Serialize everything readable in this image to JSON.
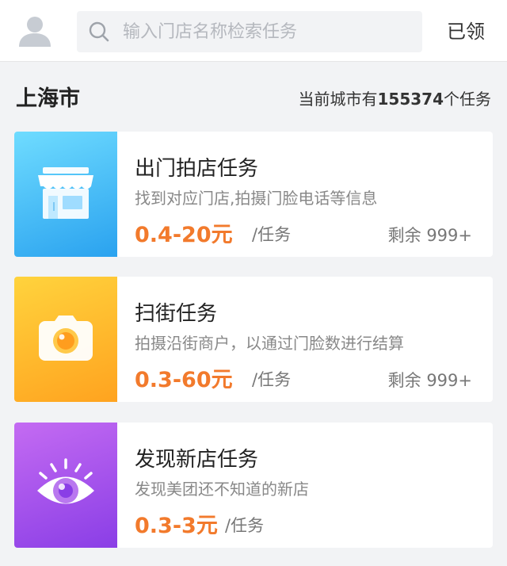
{
  "header": {
    "avatar_icon": "user-avatar-icon",
    "search": {
      "icon": "search-icon",
      "placeholder": "输入门店名称检索任务",
      "value": ""
    },
    "claimed_label": "已领"
  },
  "city": {
    "name": "上海市",
    "summary_prefix": "当前城市有",
    "task_count": "155374",
    "summary_suffix": "个任务"
  },
  "tasks": [
    {
      "title": "出门拍店任务",
      "description": "找到对应门店,拍摄门脸电话等信息",
      "price": "0.4-20元",
      "unit": "/任务",
      "remaining": "剩余 999+",
      "icon": "storefront-icon",
      "gradient_colors": [
        "#6fdcff",
        "#2aa2ef"
      ]
    },
    {
      "title": "扫街任务",
      "description": "拍摄沿街商户，以通过门脸数进行结算",
      "price": "0.3-60元",
      "unit": "/任务",
      "remaining": "剩余 999+",
      "icon": "camera-icon",
      "gradient_colors": [
        "#ffd33d",
        "#ffa31f"
      ]
    },
    {
      "title": "发现新店任务",
      "description": "发现美团还不知道的新店",
      "price": "0.3-3元",
      "unit": "/任务",
      "icon": "eye-icon",
      "gradient_colors": [
        "#c46bf2",
        "#8a3ee6"
      ]
    }
  ],
  "colors": {
    "price_accent": "#f27a2c",
    "background": "#f2f3f5"
  }
}
